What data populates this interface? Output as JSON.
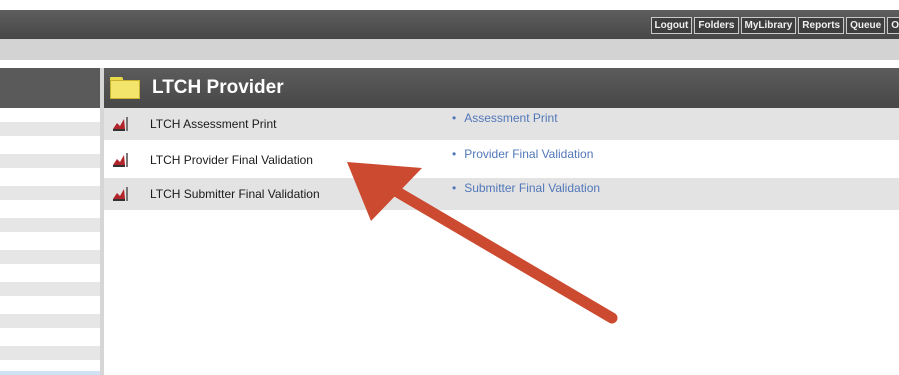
{
  "topnav": {
    "links": [
      "Logout",
      "Folders",
      "MyLibrary",
      "Reports",
      "Queue",
      "O"
    ]
  },
  "section": {
    "title": "LTCH Provider"
  },
  "reports": [
    {
      "title": "LTCH Assessment Print",
      "link": "Assessment Print"
    },
    {
      "title": "LTCH Provider Final Validation",
      "link": "Provider Final Validation"
    },
    {
      "title": "LTCH Submitter Final Validation",
      "link": "Submitter Final Validation"
    }
  ],
  "annotation": {
    "arrow_color": "#cc4a2f"
  }
}
